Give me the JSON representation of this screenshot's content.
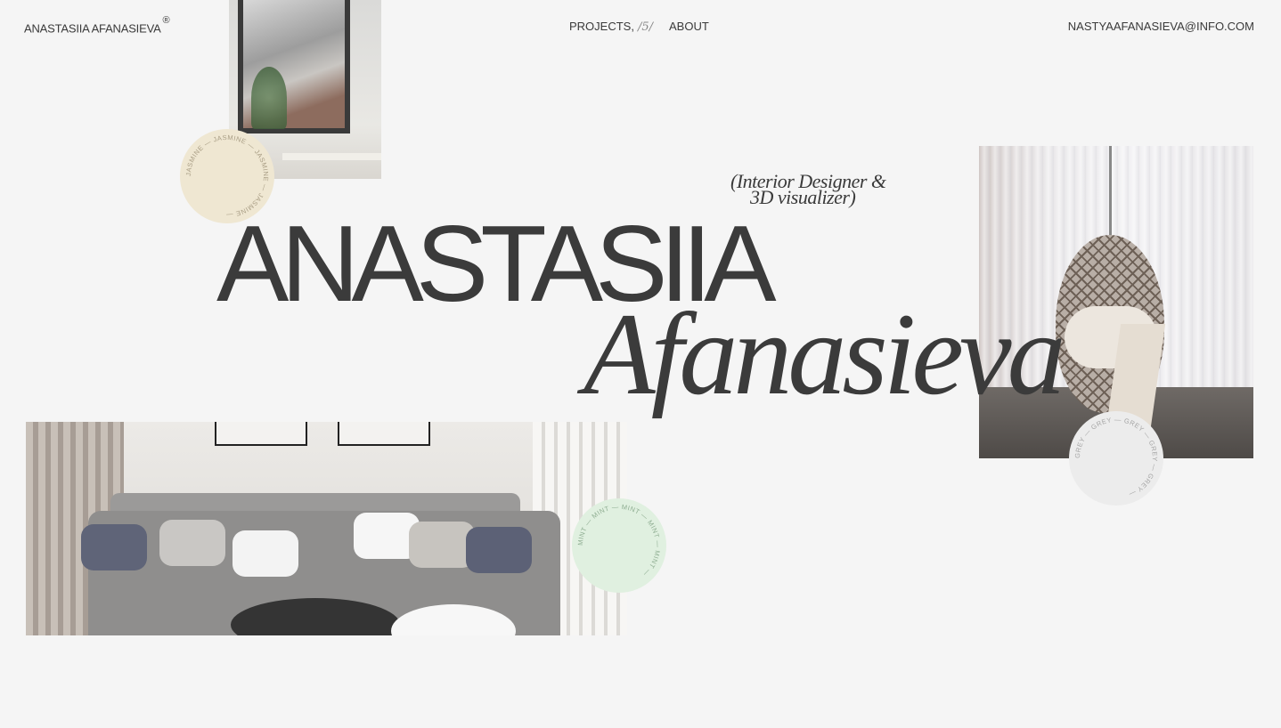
{
  "nav": {
    "logo": "ANASTASIIA AFANASIEVA",
    "logo_mark": "®",
    "projects_label": "PROJECTS,",
    "projects_count": "/5/",
    "about_label": "ABOUT",
    "email": "NASTYAAFANASIEVA@INFO.COM"
  },
  "hero": {
    "first_name": "ANASTASIIA",
    "last_name": "Afanasieva",
    "tagline_line1": "(Interior Designer &",
    "tagline_line2": "3D visualizer)"
  },
  "badges": {
    "jasmine": {
      "text": "JASMINE — JASMINE — JASMINE — JASMINE —",
      "color": "#efe7d2"
    },
    "mint": {
      "text": "MINT — MINT — MINT — MINT — MINT —",
      "color": "#e0f0e0"
    },
    "grey": {
      "text": "GREY — GREY — GREY — GREY — GREY —",
      "color": "#ececec"
    }
  },
  "colors": {
    "background": "#f5f5f5",
    "text": "#3b3b3b"
  }
}
